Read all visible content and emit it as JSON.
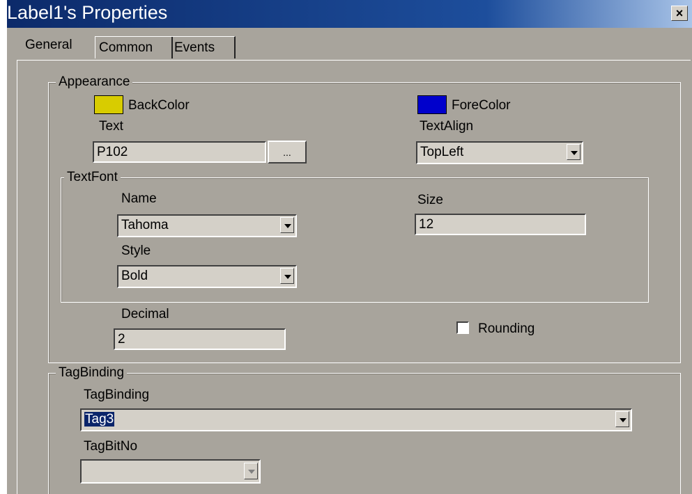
{
  "window": {
    "title": "Label1's Properties",
    "close_label": "×"
  },
  "tabs": [
    {
      "label": "General",
      "active": true
    },
    {
      "label": "Common",
      "active": false
    },
    {
      "label": "Events",
      "active": false
    }
  ],
  "appearance": {
    "legend": "Appearance",
    "backcolor": {
      "label": "BackColor",
      "color": "#d8cc00"
    },
    "forecolor": {
      "label": "ForeColor",
      "color": "#0000cc"
    },
    "text": {
      "label": "Text",
      "value": "P102",
      "button_label": "..."
    },
    "textalign": {
      "label": "TextAlign",
      "value": "TopLeft"
    },
    "textfont": {
      "legend": "TextFont",
      "name": {
        "label": "Name",
        "value": "Tahoma"
      },
      "size": {
        "label": "Size",
        "value": "12"
      },
      "style": {
        "label": "Style",
        "value": "Bold"
      }
    },
    "decimal": {
      "label": "Decimal",
      "value": "2"
    },
    "rounding": {
      "label": "Rounding",
      "checked": false
    }
  },
  "tagbinding": {
    "legend": "TagBinding",
    "binding": {
      "label": "TagBinding",
      "value": "Tag3"
    },
    "bitno": {
      "label": "TagBitNo",
      "value": ""
    }
  }
}
